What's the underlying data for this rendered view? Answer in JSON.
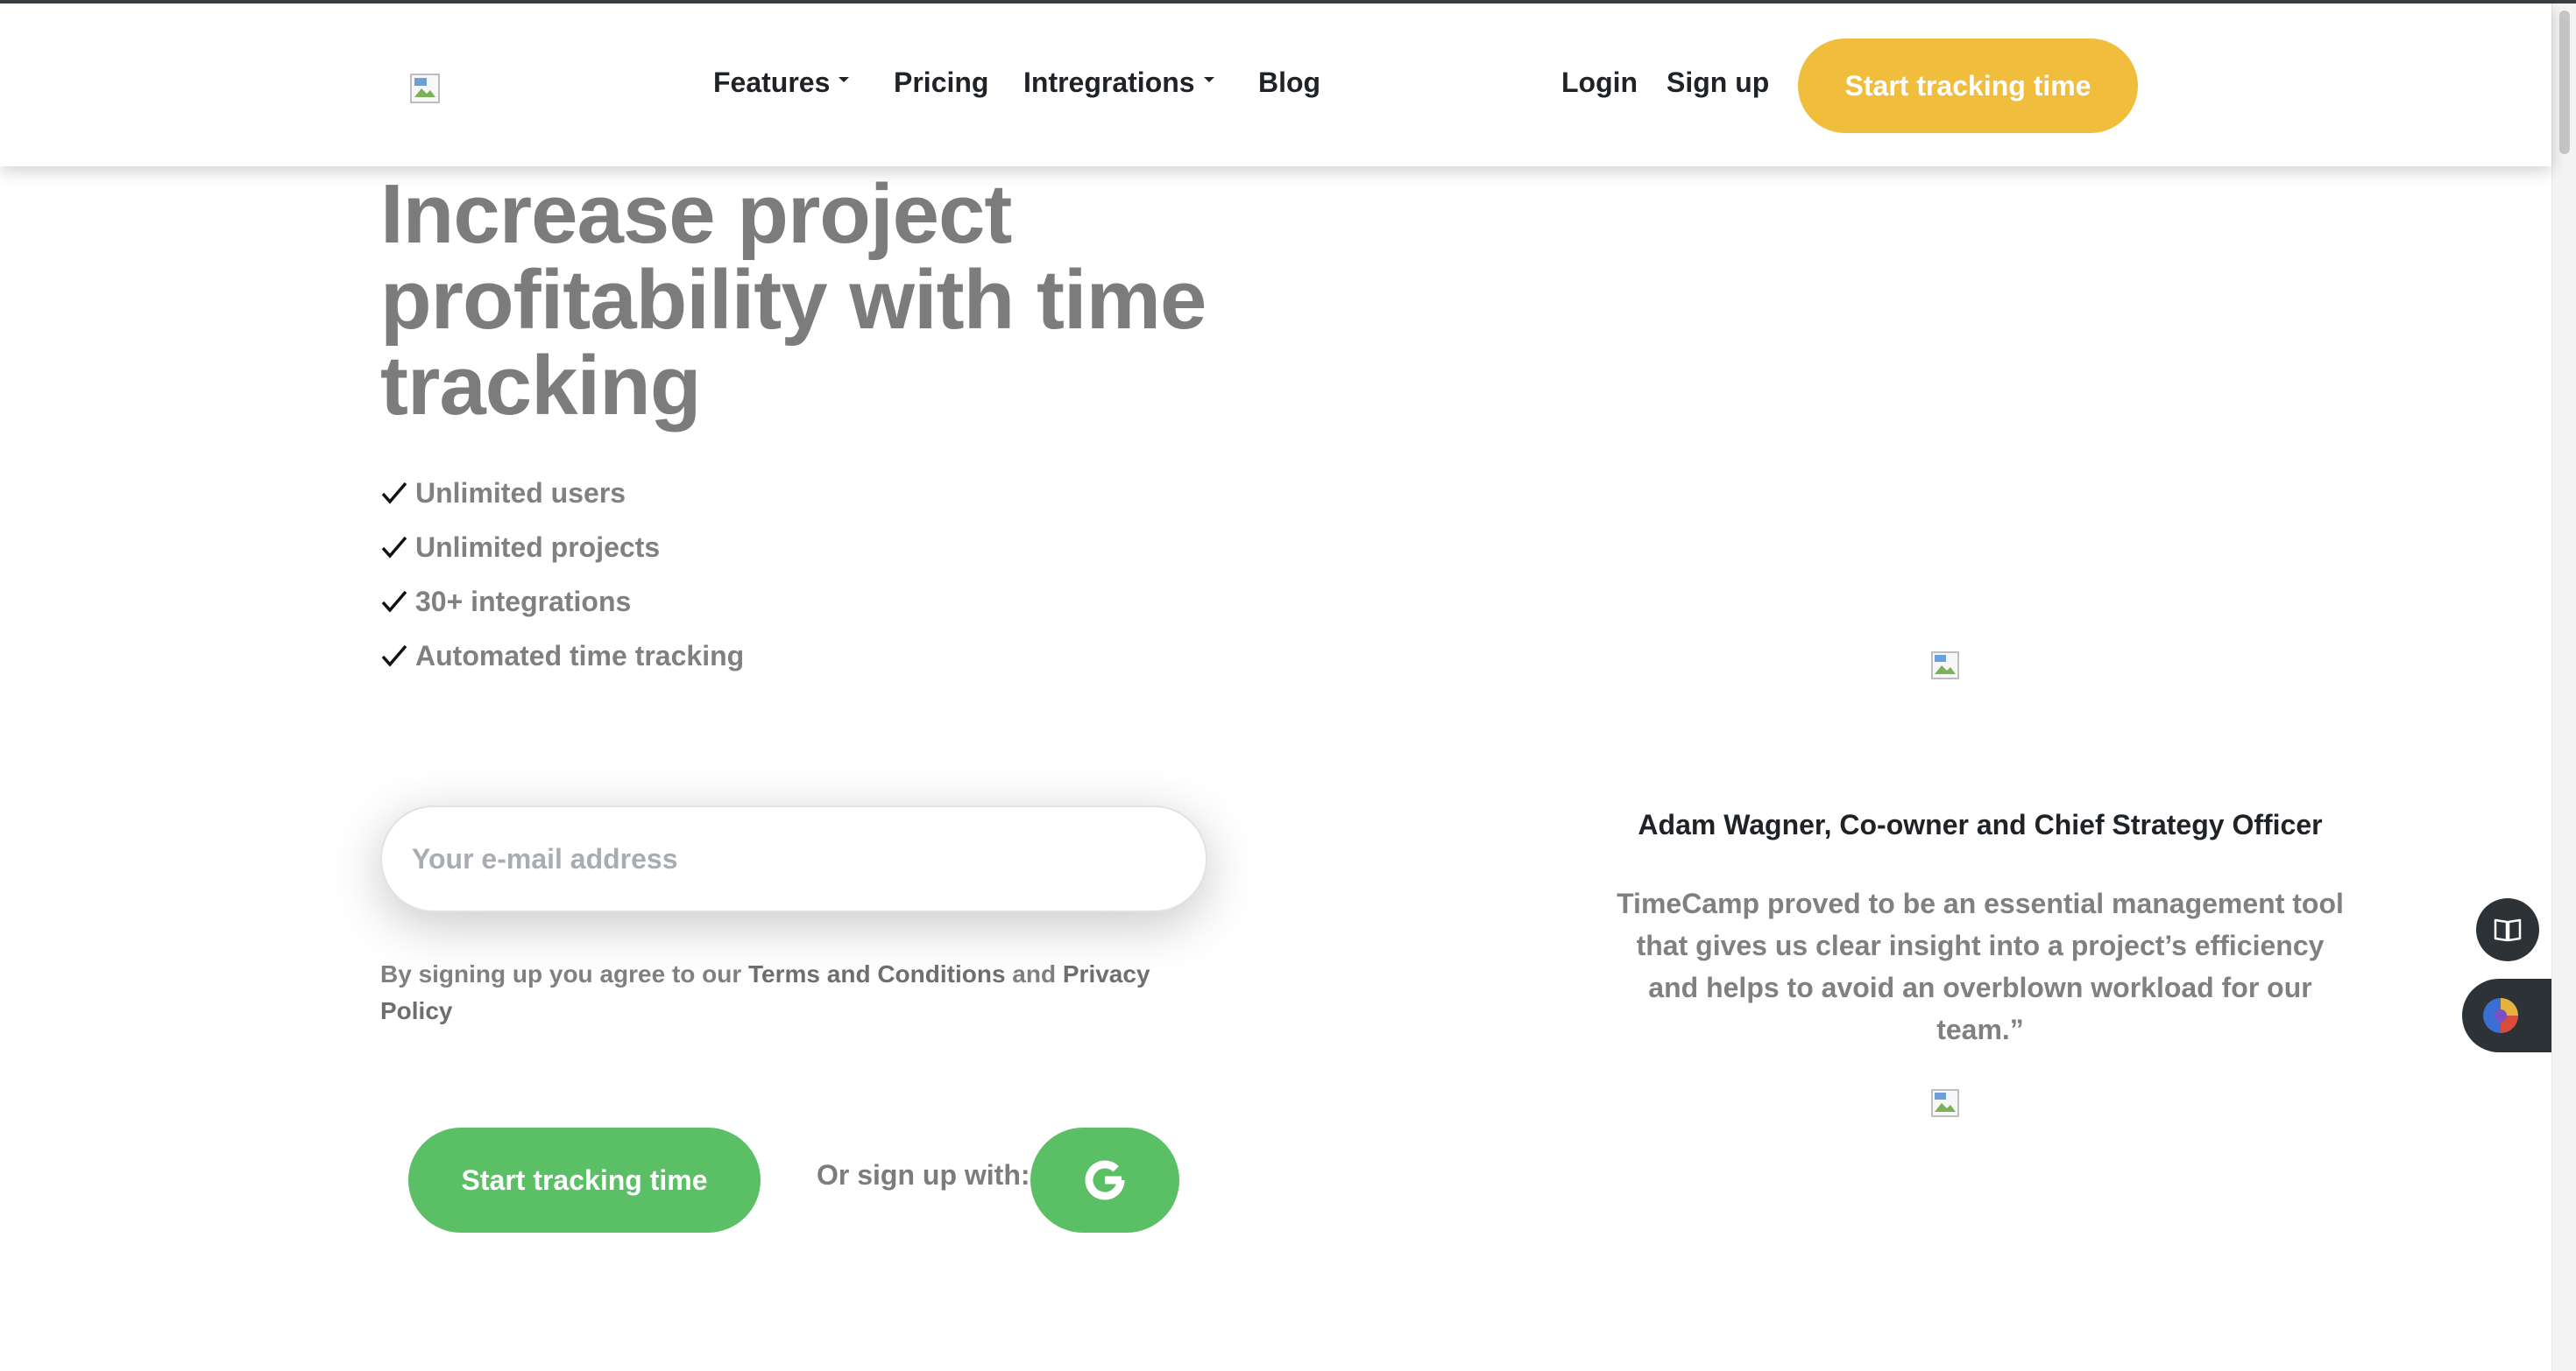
{
  "header": {
    "nav": [
      {
        "label": "Features",
        "has_dropdown": true
      },
      {
        "label": "Pricing",
        "has_dropdown": false
      },
      {
        "label": "Intregrations",
        "has_dropdown": true
      },
      {
        "label": "Blog",
        "has_dropdown": false
      }
    ],
    "login_label": "Login",
    "signup_label": "Sign up",
    "cta_label": "Start tracking time"
  },
  "hero": {
    "title": "Increase project profitability with time tracking",
    "features": [
      "Unlimited users",
      "Unlimited projects",
      "30+ integrations",
      "Automated time tracking"
    ],
    "email_placeholder": "Your e-mail address",
    "terms_prefix": "By signing up you agree to our ",
    "terms_link": "Terms and Conditions",
    "terms_and": " and ",
    "privacy_link": "Privacy Policy",
    "cta_label": "Start tracking time",
    "or_label": "Or sign up with:"
  },
  "testimonial": {
    "name": "Adam Wagner, Co-owner and Chief Strategy Officer",
    "quote": "TimeCamp proved to be an essential management tool that gives us clear insight into a project’s efficiency and helps to avoid an overblown workload for our team.”"
  },
  "colors": {
    "accent_yellow": "#f0bd3d",
    "accent_green": "#5bbf66",
    "text_dark": "#1f2327",
    "text_gray": "#808080"
  },
  "icons": [
    "caret-down-icon",
    "check-icon",
    "google-icon",
    "book-icon",
    "chat-avatar-icon",
    "broken-image-icon"
  ]
}
